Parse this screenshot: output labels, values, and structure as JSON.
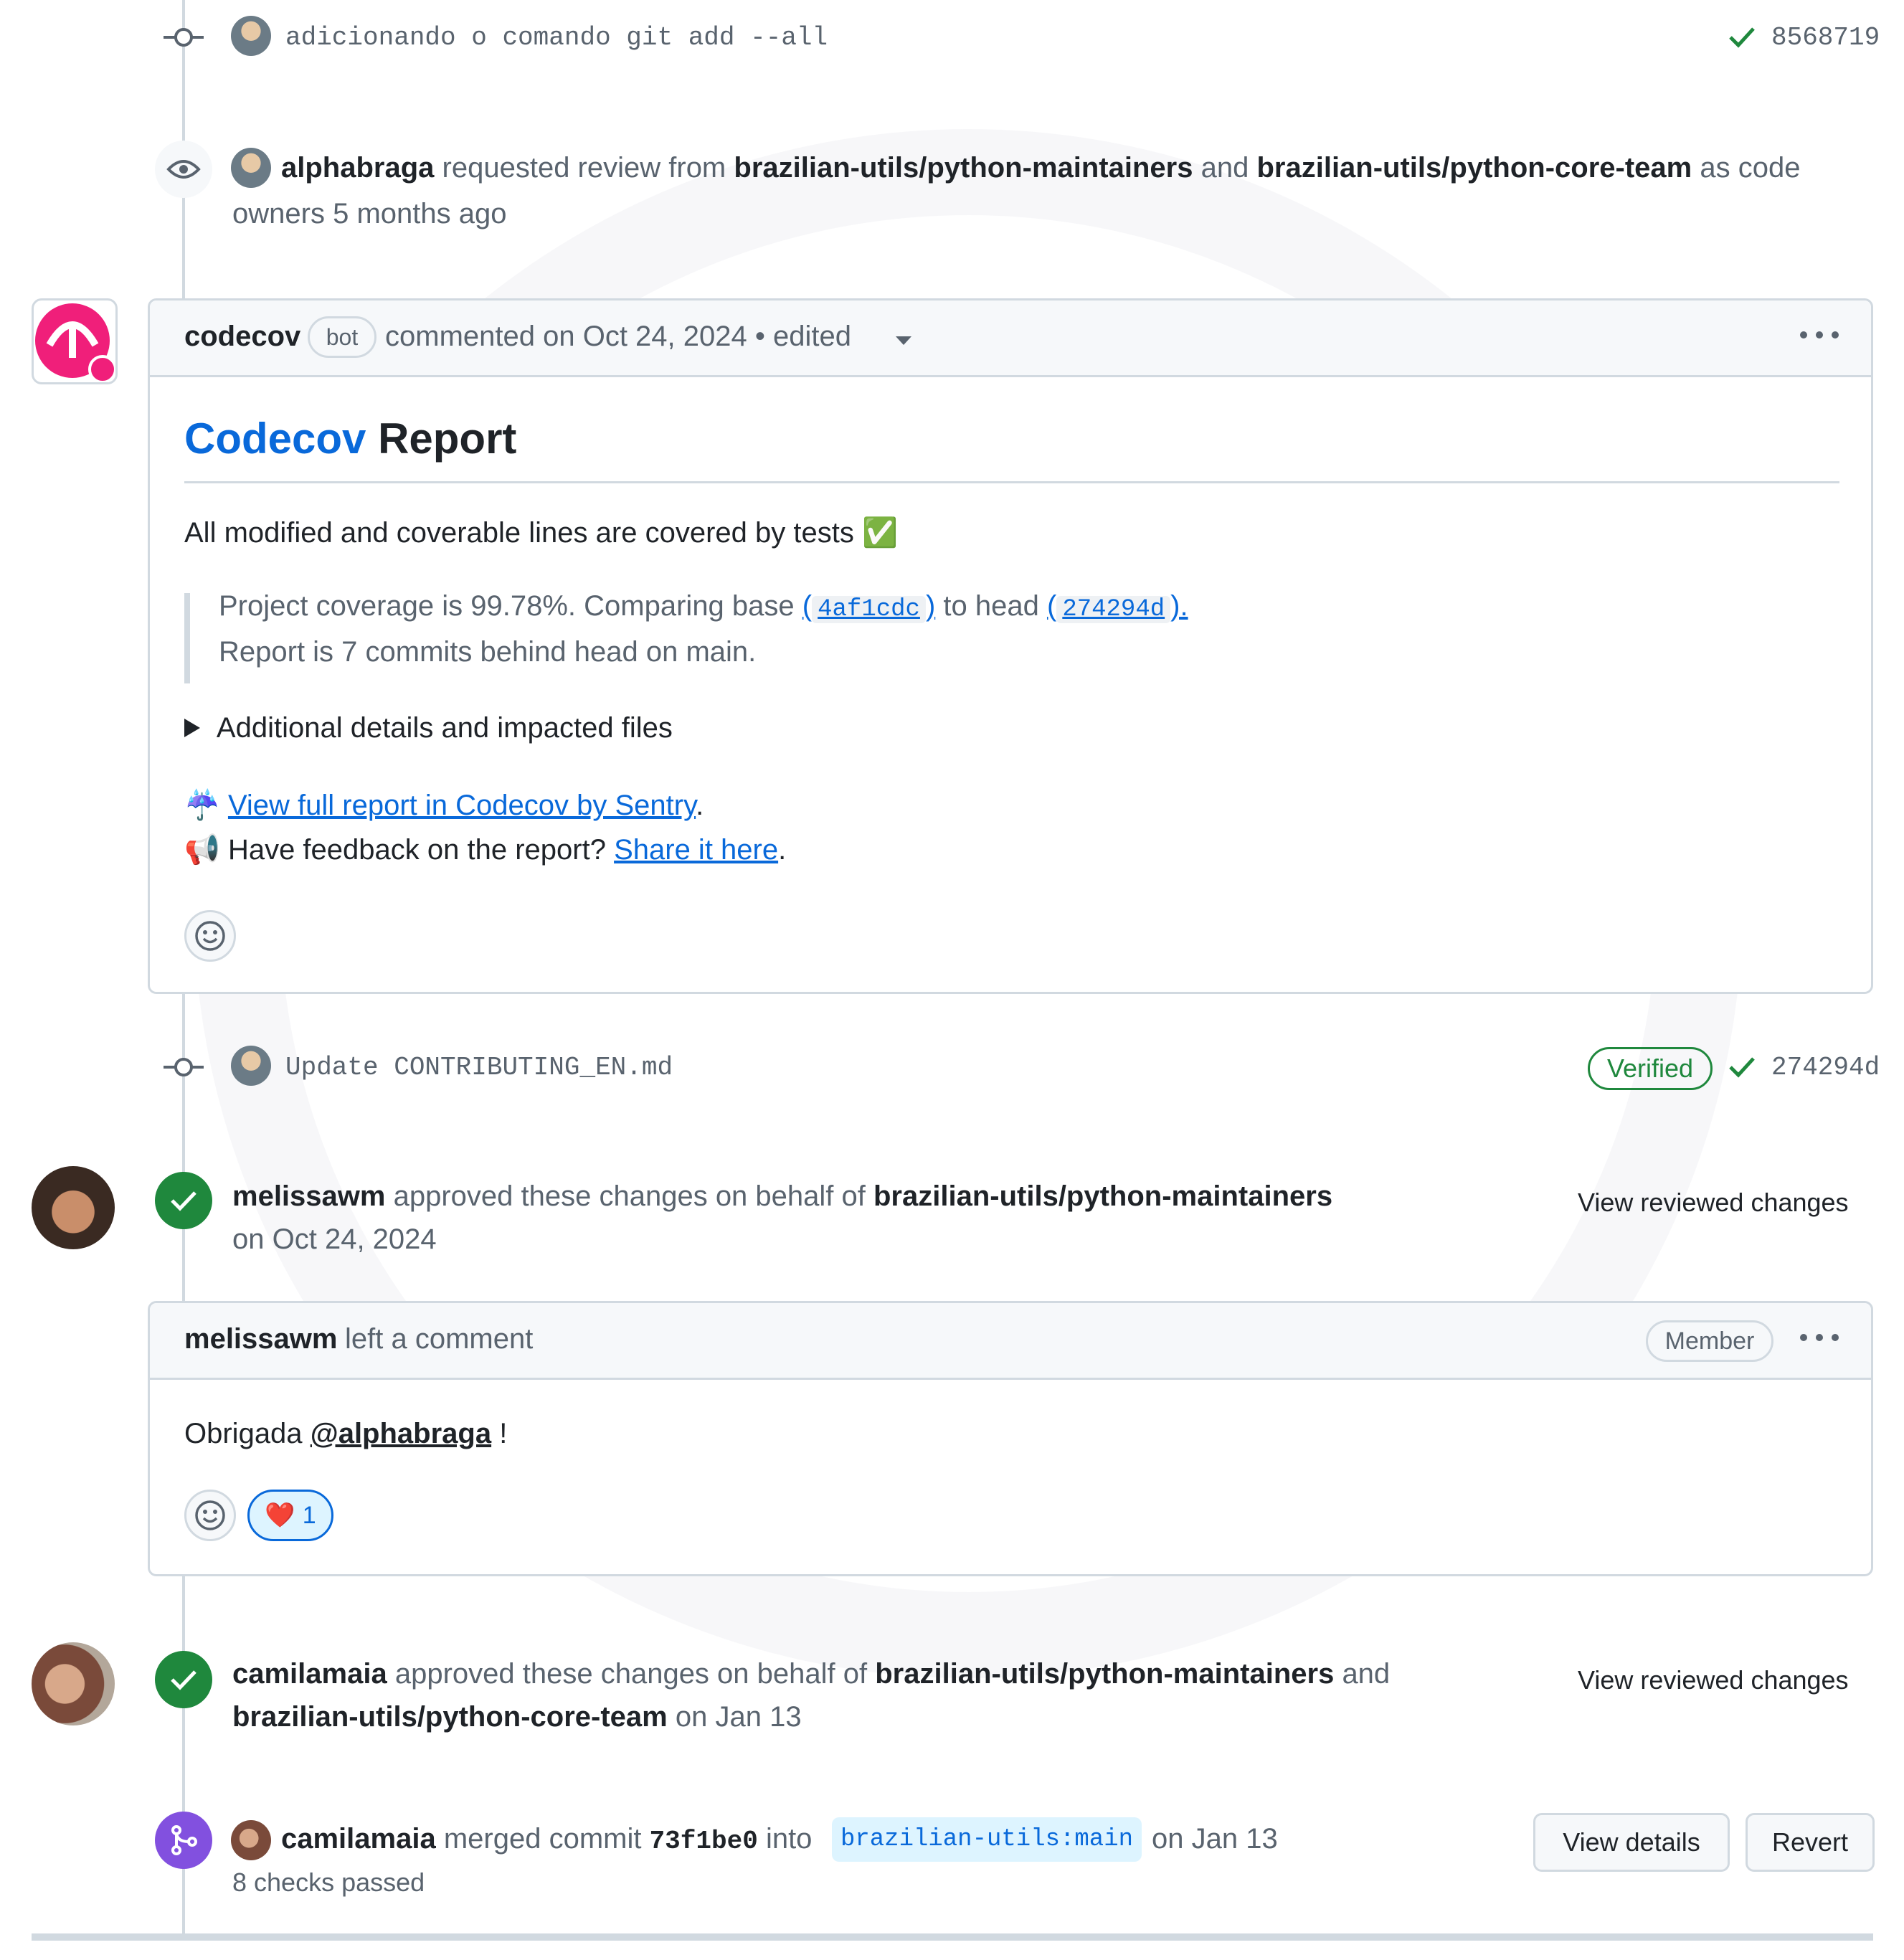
{
  "commit1": {
    "message": "adicionando o comando git add --all",
    "sha": "8568719"
  },
  "review_request": {
    "user": "alphabraga",
    "text1": "requested review from",
    "team1": "brazilian-utils/python-maintainers",
    "and": "and",
    "team2": "brazilian-utils/python-core-team",
    "text2": "as code",
    "text3": "owners",
    "time": "5 months ago"
  },
  "codecov_comment": {
    "author": "codecov",
    "badge": "bot",
    "meta": "commented on Oct 24, 2024 • edited",
    "heading_link": "Codecov",
    "heading_rest": "Report",
    "line1": "All modified and coverable lines are covered by tests",
    "check_emoji": "✅",
    "quote_pre": "Project coverage is 99.78%. Comparing base",
    "base_open": "(",
    "base_sha": "4af1cdc",
    "base_close": ")",
    "quote_mid": "to head",
    "head_open": "(",
    "head_sha": "274294d",
    "head_close": ").",
    "quote_line2": "Report is 7 commits behind head on main.",
    "details_toggle": "Additional details and impacted files",
    "report_emoji": "☔",
    "report_link": "View full report in Codecov by Sentry",
    "report_period": ".",
    "feedback_emoji": "📢",
    "feedback_text": "Have feedback on the report?",
    "feedback_link": "Share it here",
    "feedback_period": "."
  },
  "commit2": {
    "message": "Update CONTRIBUTING_EN.md",
    "verified": "Verified",
    "sha": "274294d"
  },
  "approval1": {
    "user": "melissawm",
    "text": "approved these changes on behalf of",
    "team": "brazilian-utils/python-maintainers",
    "date": "on Oct 24, 2024",
    "view": "View reviewed changes"
  },
  "melissa_comment": {
    "author": "melissawm",
    "meta": "left a comment",
    "role": "Member",
    "body_pre": "Obrigada",
    "mention": "@alphabraga",
    "body_post": "!",
    "reaction_emoji": "❤️",
    "reaction_count": "1"
  },
  "approval2": {
    "user": "camilamaia",
    "text": "approved these changes on behalf of",
    "team1": "brazilian-utils/python-maintainers",
    "and": "and",
    "team2": "brazilian-utils/python-core-team",
    "date": "on Jan 13",
    "view": "View reviewed changes"
  },
  "merge": {
    "user": "camilamaia",
    "text": "merged commit",
    "sha": "73f1be0",
    "into": "into",
    "branch": "brazilian-utils:main",
    "date": "on Jan 13",
    "checks": "8 checks passed",
    "view_details": "View details",
    "revert": "Revert"
  },
  "colors": {
    "accent": "#0969da",
    "success": "#1f883d",
    "merged": "#8250df",
    "codecov": "#f01f7a"
  },
  "icons": [
    "commit-icon",
    "eye-icon",
    "check-icon",
    "kebab-icon",
    "smiley-icon",
    "merge-icon",
    "caret-icon",
    "triangle-icon"
  ]
}
